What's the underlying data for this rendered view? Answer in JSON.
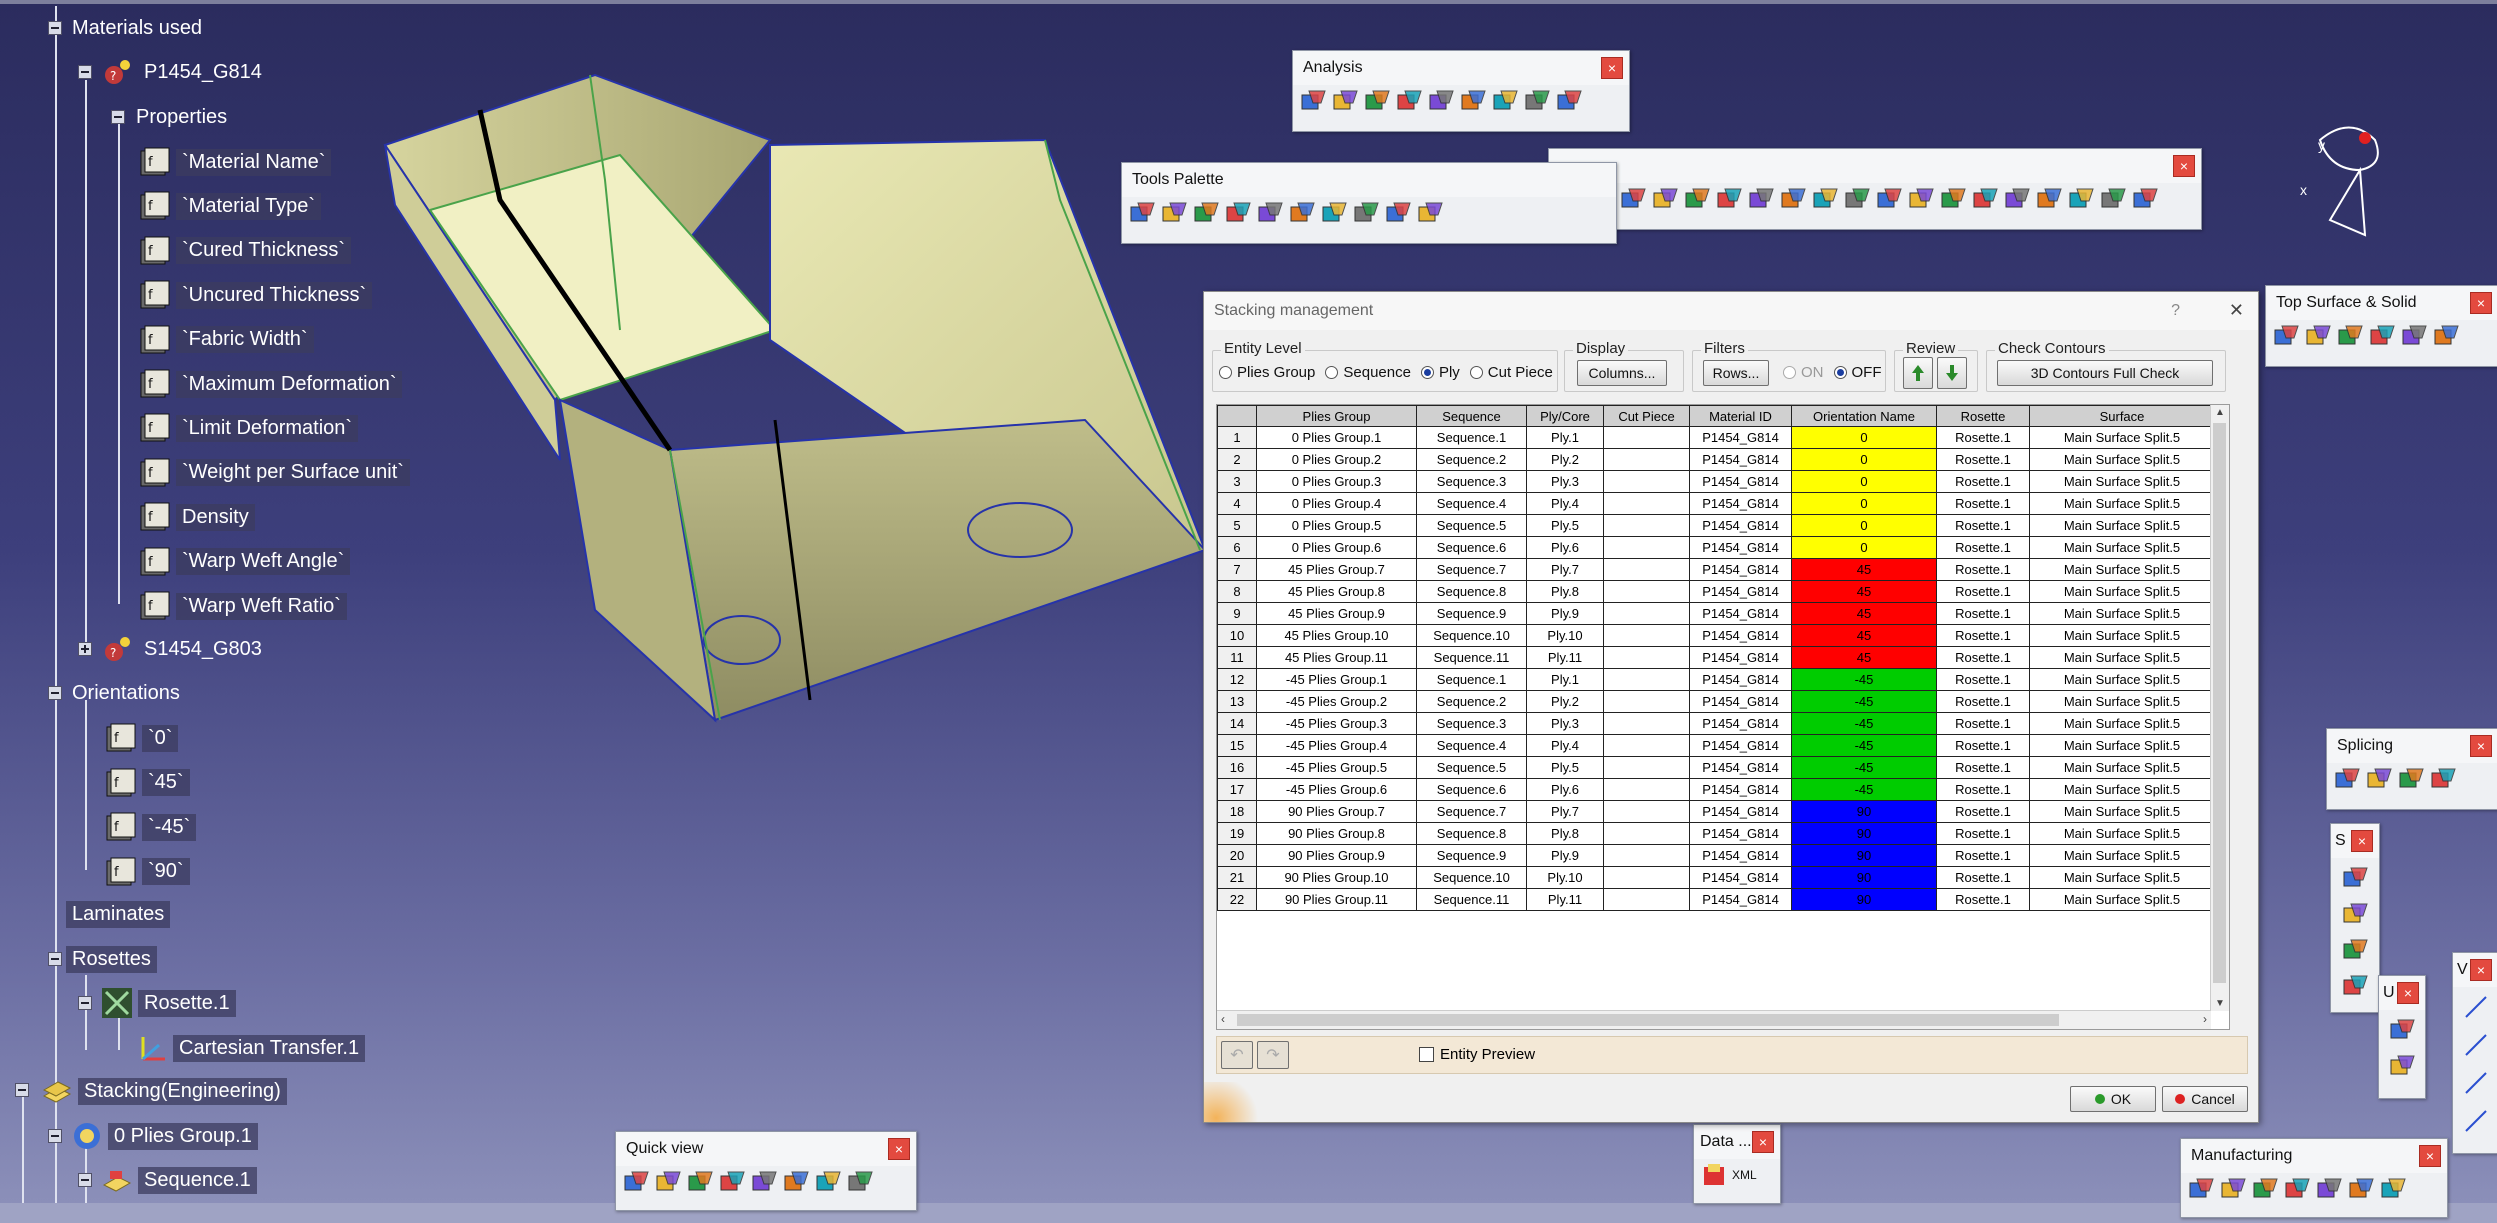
{
  "tree": {
    "materials_used": "Materials used",
    "p1454": "P1454_G814",
    "properties": "Properties",
    "props": [
      "`Material Name`",
      "`Material Type`",
      "`Cured Thickness`",
      "`Uncured Thickness`",
      "`Fabric Width`",
      "`Maximum Deformation`",
      "`Limit Deformation`",
      "`Weight per Surface unit`",
      "Density",
      "`Warp Weft Angle`",
      "`Warp Weft Ratio`"
    ],
    "s1454": "S1454_G803",
    "orientations": "Orientations",
    "orients": [
      "`0`",
      "`45`",
      "`-45`",
      "`90`"
    ],
    "laminates": "Laminates",
    "rosettes": "Rosettes",
    "rosette1": "Rosette.1",
    "cartesian": "Cartesian Transfer.1",
    "stacking": "Stacking(Engineering)",
    "plies_group": "0 Plies Group.1",
    "sequence": "Sequence.1"
  },
  "toolbars": {
    "analysis": "Analysis",
    "tools_palette": "Tools Palette",
    "top_surface": "Top Surface & Solid",
    "splicing": "Splicing",
    "quick_view": "Quick view",
    "data": "Data ...",
    "manufacturing": "Manufacturing",
    "close": "×",
    "s_frag": "S",
    "u_frag": "U",
    "v_frag": "V",
    "xml": "XML"
  },
  "compass": {
    "x": "x",
    "y": "y"
  },
  "dialog": {
    "title": "Stacking management",
    "help": "?",
    "close": "✕",
    "entity_level": "Entity Level",
    "entity_options": [
      "Plies Group",
      "Sequence",
      "Ply",
      "Cut Piece"
    ],
    "display": "Display",
    "columns_btn": "Columns...",
    "filters": "Filters",
    "rows_btn": "Rows...",
    "on": "ON",
    "off": "OFF",
    "review": "Review",
    "check_contours": "Check Contours",
    "contours_btn": "3D Contours Full Check",
    "entity_preview": "Entity Preview",
    "ok": "OK",
    "cancel": "Cancel",
    "headers": [
      "",
      "Plies Group",
      "Sequence",
      "Ply/Core",
      "Cut Piece",
      "Material ID",
      "Orientation Name",
      "Rosette",
      "Surface"
    ],
    "rows": [
      [
        "1",
        "0 Plies Group.1",
        "Sequence.1",
        "Ply.1",
        "",
        "P1454_G814",
        "0",
        "Rosette.1",
        "Main Surface Split.5"
      ],
      [
        "2",
        "0 Plies Group.2",
        "Sequence.2",
        "Ply.2",
        "",
        "P1454_G814",
        "0",
        "Rosette.1",
        "Main Surface Split.5"
      ],
      [
        "3",
        "0 Plies Group.3",
        "Sequence.3",
        "Ply.3",
        "",
        "P1454_G814",
        "0",
        "Rosette.1",
        "Main Surface Split.5"
      ],
      [
        "4",
        "0 Plies Group.4",
        "Sequence.4",
        "Ply.4",
        "",
        "P1454_G814",
        "0",
        "Rosette.1",
        "Main Surface Split.5"
      ],
      [
        "5",
        "0 Plies Group.5",
        "Sequence.5",
        "Ply.5",
        "",
        "P1454_G814",
        "0",
        "Rosette.1",
        "Main Surface Split.5"
      ],
      [
        "6",
        "0 Plies Group.6",
        "Sequence.6",
        "Ply.6",
        "",
        "P1454_G814",
        "0",
        "Rosette.1",
        "Main Surface Split.5"
      ],
      [
        "7",
        "45 Plies Group.7",
        "Sequence.7",
        "Ply.7",
        "",
        "P1454_G814",
        "45",
        "Rosette.1",
        "Main Surface Split.5"
      ],
      [
        "8",
        "45 Plies Group.8",
        "Sequence.8",
        "Ply.8",
        "",
        "P1454_G814",
        "45",
        "Rosette.1",
        "Main Surface Split.5"
      ],
      [
        "9",
        "45 Plies Group.9",
        "Sequence.9",
        "Ply.9",
        "",
        "P1454_G814",
        "45",
        "Rosette.1",
        "Main Surface Split.5"
      ],
      [
        "10",
        "45 Plies Group.10",
        "Sequence.10",
        "Ply.10",
        "",
        "P1454_G814",
        "45",
        "Rosette.1",
        "Main Surface Split.5"
      ],
      [
        "11",
        "45 Plies Group.11",
        "Sequence.11",
        "Ply.11",
        "",
        "P1454_G814",
        "45",
        "Rosette.1",
        "Main Surface Split.5"
      ],
      [
        "12",
        "-45 Plies Group.1",
        "Sequence.1",
        "Ply.1",
        "",
        "P1454_G814",
        "-45",
        "Rosette.1",
        "Main Surface Split.5"
      ],
      [
        "13",
        "-45 Plies Group.2",
        "Sequence.2",
        "Ply.2",
        "",
        "P1454_G814",
        "-45",
        "Rosette.1",
        "Main Surface Split.5"
      ],
      [
        "14",
        "-45 Plies Group.3",
        "Sequence.3",
        "Ply.3",
        "",
        "P1454_G814",
        "-45",
        "Rosette.1",
        "Main Surface Split.5"
      ],
      [
        "15",
        "-45 Plies Group.4",
        "Sequence.4",
        "Ply.4",
        "",
        "P1454_G814",
        "-45",
        "Rosette.1",
        "Main Surface Split.5"
      ],
      [
        "16",
        "-45 Plies Group.5",
        "Sequence.5",
        "Ply.5",
        "",
        "P1454_G814",
        "-45",
        "Rosette.1",
        "Main Surface Split.5"
      ],
      [
        "17",
        "-45 Plies Group.6",
        "Sequence.6",
        "Ply.6",
        "",
        "P1454_G814",
        "-45",
        "Rosette.1",
        "Main Surface Split.5"
      ],
      [
        "18",
        "90 Plies Group.7",
        "Sequence.7",
        "Ply.7",
        "",
        "P1454_G814",
        "90",
        "Rosette.1",
        "Main Surface Split.5"
      ],
      [
        "19",
        "90 Plies Group.8",
        "Sequence.8",
        "Ply.8",
        "",
        "P1454_G814",
        "90",
        "Rosette.1",
        "Main Surface Split.5"
      ],
      [
        "20",
        "90 Plies Group.9",
        "Sequence.9",
        "Ply.9",
        "",
        "P1454_G814",
        "90",
        "Rosette.1",
        "Main Surface Split.5"
      ],
      [
        "21",
        "90 Plies Group.10",
        "Sequence.10",
        "Ply.10",
        "",
        "P1454_G814",
        "90",
        "Rosette.1",
        "Main Surface Split.5"
      ],
      [
        "22",
        "90 Plies Group.11",
        "Sequence.11",
        "Ply.11",
        "",
        "P1454_G814",
        "90",
        "Rosette.1",
        "Main Surface Split.5"
      ]
    ],
    "orientation_colors": {
      "0": "#ffff00",
      "45": "#ff0000",
      "-45": "#00cc00",
      "90": "#0000ff"
    }
  }
}
